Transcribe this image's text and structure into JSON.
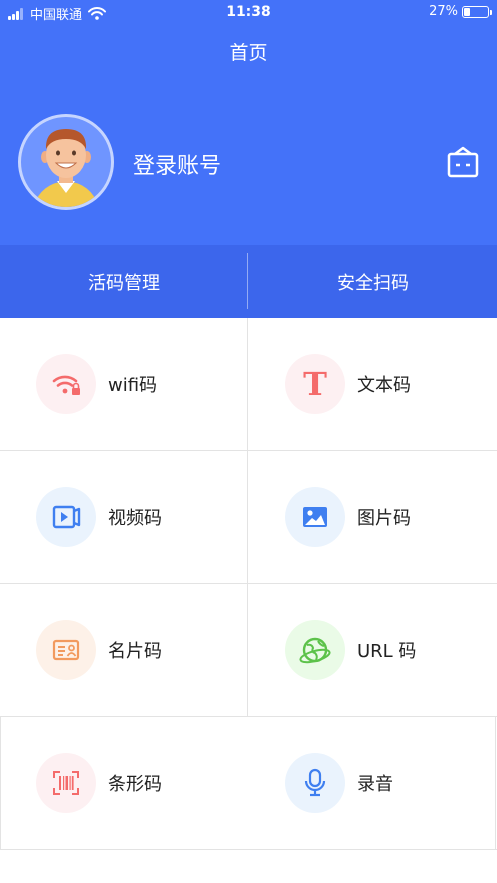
{
  "status_bar": {
    "carrier": "中国联通",
    "time": "11:38",
    "battery": "27%",
    "battery_level": 0.27
  },
  "header": {
    "title": "首页",
    "login_label": "登录账号",
    "message_icon": "message-box-icon"
  },
  "tabs": [
    {
      "label": "活码管理"
    },
    {
      "label": "安全扫码"
    }
  ],
  "grid": {
    "items": [
      {
        "label": "wifi码",
        "icon": "wifi-lock-icon",
        "color": "#f46b6b",
        "bg": "#fdf0f2"
      },
      {
        "label": "文本码",
        "icon": "text-t-icon",
        "color": "#f46b6b",
        "bg": "#fdf0f2"
      },
      {
        "label": "视频码",
        "icon": "video-icon",
        "color": "#3f7ff0",
        "bg": "#eaf3fd"
      },
      {
        "label": "图片码",
        "icon": "image-icon",
        "color": "#3f7ff0",
        "bg": "#eaf3fd"
      },
      {
        "label": "名片码",
        "icon": "business-card-icon",
        "color": "#f29a5e",
        "bg": "#fdf1e8"
      },
      {
        "label": "URL 码",
        "icon": "url-globe-icon",
        "color": "#5cc24a",
        "bg": "#eafbe7"
      },
      {
        "label": "条形码",
        "icon": "barcode-icon",
        "color": "#f46b6b",
        "bg": "#fdf0f2"
      },
      {
        "label": "录音",
        "icon": "microphone-icon",
        "color": "#3f7ff0",
        "bg": "#eaf3fd"
      }
    ]
  },
  "colors": {
    "header_bg": "#4472f9",
    "tabbar_bg": "#3c66ec"
  }
}
